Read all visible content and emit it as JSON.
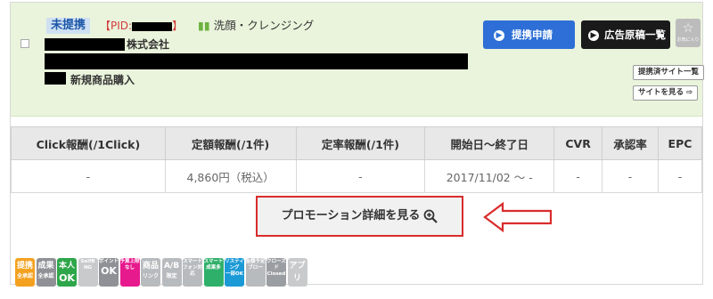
{
  "header": {
    "status": "未提携",
    "pid_prefix": "【PID:",
    "pid_suffix": "】",
    "category_icon": "leaf-icon",
    "category": "洗顔・クレンジング",
    "company_suffix": "株式会社",
    "product_suffix": "新規商品購入"
  },
  "buttons": {
    "apply": "提携申請",
    "ads": "広告原稿一覧",
    "favorite_label": "お気に入り",
    "partner_sites": "提携済サイト一覧",
    "view_site": "サイトを見る"
  },
  "colors": {
    "header_bg": "#eaf4dc",
    "apply_blue": "#2d6fd6",
    "highlight_red": "#d92c2c"
  },
  "table": {
    "headers": [
      "Click報酬(/1Click)",
      "定額報酬(/1件)",
      "定率報酬(/1件)",
      "開始日～終了日",
      "CVR",
      "承認率",
      "EPC"
    ],
    "row": [
      "-",
      "4,860円（税込）",
      "-",
      "2017/11/02 ～ -",
      "-",
      "-",
      "-"
    ]
  },
  "detail_button": "プロモーション詳細を見る",
  "badges": [
    {
      "name": "teikei-zenshounin-badge",
      "top": "提携",
      "bot": "全承認",
      "color": "#f3a11f"
    },
    {
      "name": "seika-zenshounin-badge",
      "top": "成果",
      "bot": "全承認",
      "color": "#8f9196"
    },
    {
      "name": "honnin-ok-badge",
      "top": "本人",
      "bot": "OK",
      "color": "#2ea64a"
    },
    {
      "name": "selfback-ng-badge",
      "top": "SelfB",
      "bot": "NG",
      "color": "#c8cacc"
    },
    {
      "name": "point-ok-badge",
      "top": "ポイント",
      "bot": "OK",
      "color": "#8f9196"
    },
    {
      "name": "yosan-joubgen-badge",
      "top": "予算上限",
      "bot": "なし",
      "color": "#e61a8d"
    },
    {
      "name": "shouhin-link-badge",
      "top": "商品",
      "bot": "リンク",
      "color": "#b8bbbe"
    },
    {
      "name": "ab-gentei-badge",
      "top": "A/B",
      "bot": "限定",
      "color": "#b8bbbe"
    },
    {
      "name": "smartphone-taiou-badge",
      "top": "スマート",
      "bot": "フォン対応",
      "color": "#b8bbbe"
    },
    {
      "name": "smartphone-seika-badge",
      "top": "スマート",
      "bot": "成果多",
      "color": "#2fb06a"
    },
    {
      "name": "listing-ichibu-ok-badge",
      "top": "リスティング",
      "bot": "一部OK",
      "color": "#1b9ad6"
    },
    {
      "name": "kingaku-yotei-badge",
      "top": "金額予定",
      "bot": "ブロー",
      "color": "#b8bbbe"
    },
    {
      "name": "closed-badge",
      "top": "クローズド",
      "bot": "Closed",
      "color": "#9a9da1"
    },
    {
      "name": "app-badge",
      "top": "アプリ",
      "bot": "",
      "color": "#c8cacc"
    }
  ]
}
